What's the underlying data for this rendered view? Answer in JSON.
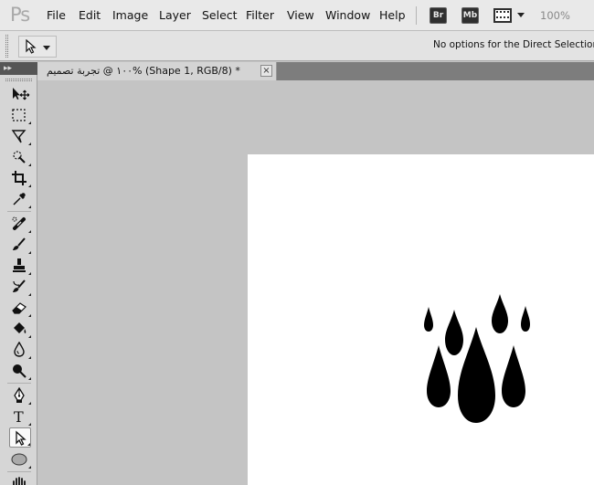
{
  "app": {
    "logo": "Ps",
    "menus": [
      "File",
      "Edit",
      "Image",
      "Layer",
      "Select",
      "Filter",
      "View",
      "Window",
      "Help"
    ],
    "bridge_label": "Br",
    "minibridge_label": "Mb",
    "zoom": "100%"
  },
  "options_bar": {
    "message": "No options for the Direct Selection Tool."
  },
  "toolbar": {
    "collapse_label": "▸▸",
    "tools": [
      "move-tool",
      "rectangular-marquee-tool",
      "lasso-tool",
      "quick-selection-tool",
      "crop-tool",
      "eyedropper-tool",
      "spot-healing-brush-tool",
      "brush-tool",
      "clone-stamp-tool",
      "history-brush-tool",
      "eraser-tool",
      "paint-bucket-tool",
      "blur-tool",
      "dodge-tool",
      "pen-tool",
      "type-tool",
      "direct-selection-tool",
      "ellipse-tool",
      "hand-tool"
    ],
    "active_tool": "direct-selection-tool"
  },
  "document": {
    "tab_title": "١٠٠ @ تجربة تصميم% (Shape 1, RGB/8) *",
    "close_label": "×"
  },
  "colors": {
    "menubar_bg": "#e9e9e9",
    "workspace_bg": "#c4c4c4",
    "canvas_bg": "#ffffff",
    "shape_fill": "#000000"
  },
  "canvas": {
    "shape_description_icon": "raindrop-shapes"
  }
}
